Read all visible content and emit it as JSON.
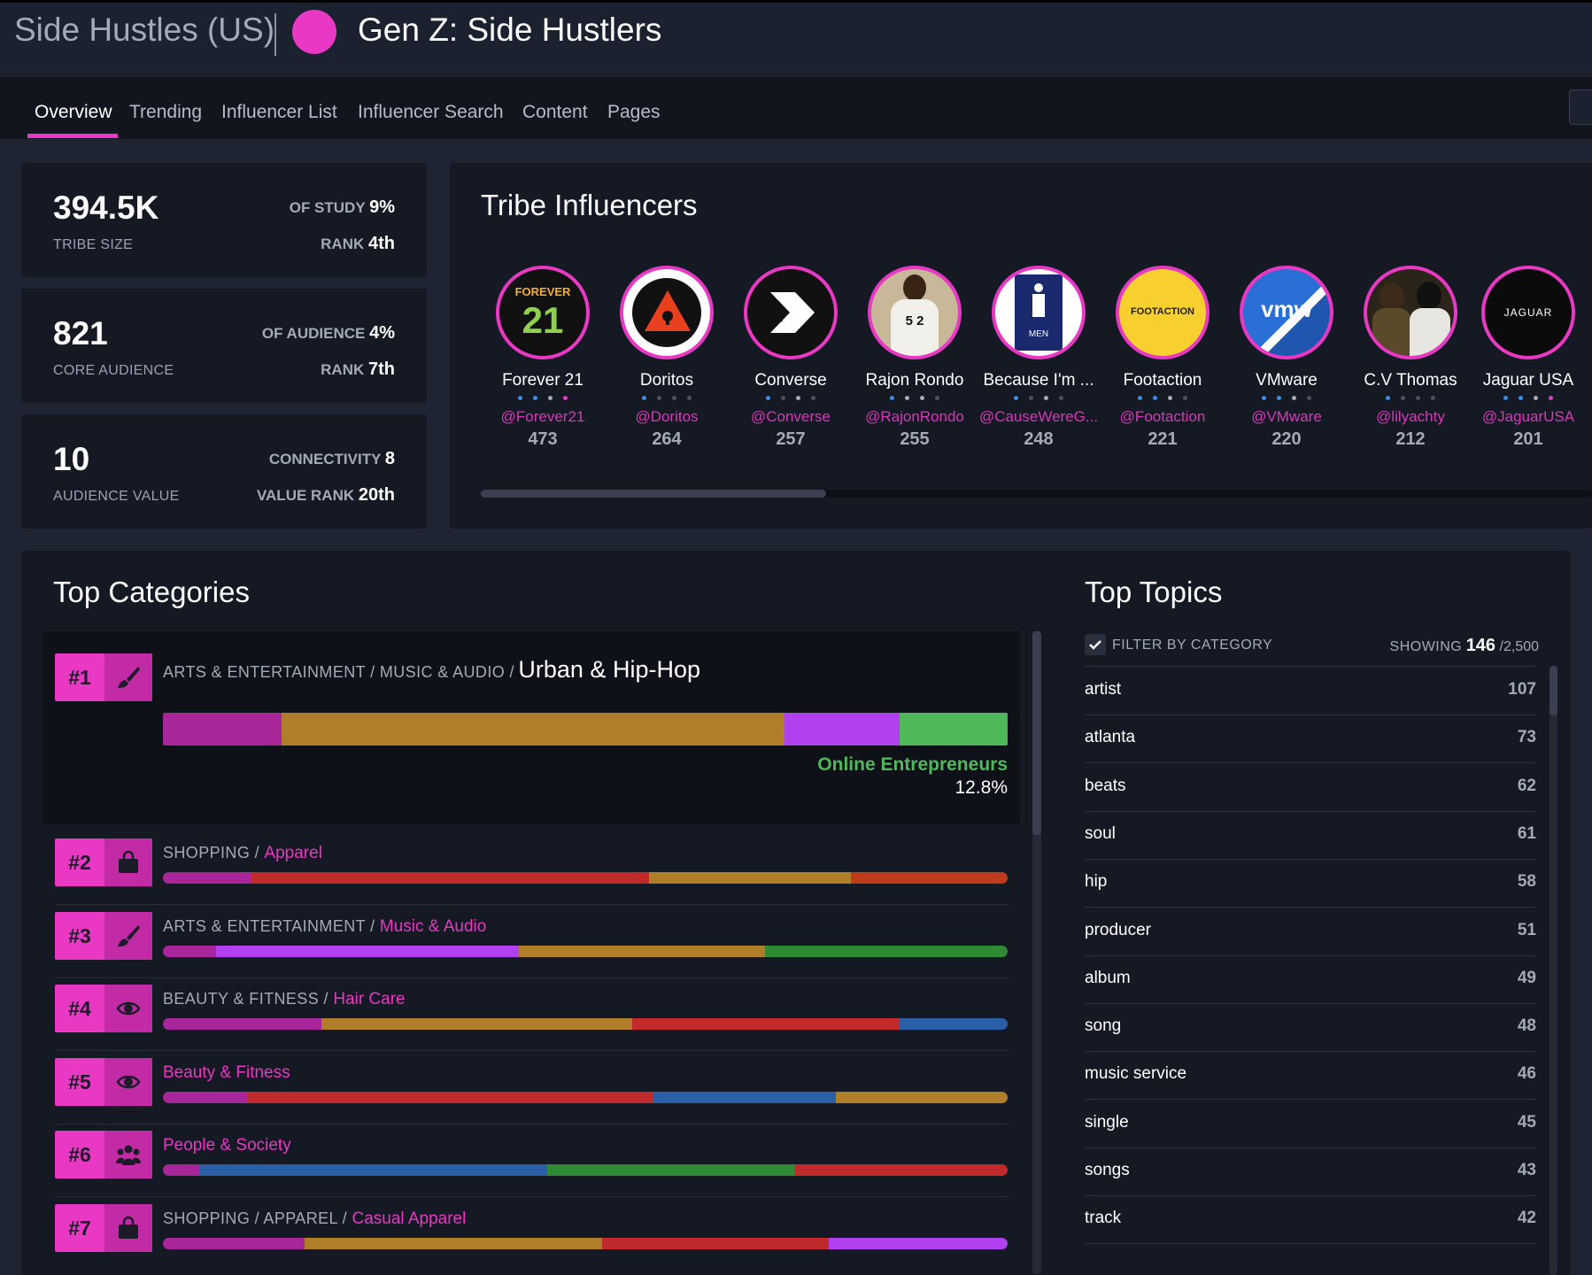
{
  "header": {
    "breadcrumb": "Side Hustles (US)",
    "title": "Gen Z: Side Hustlers",
    "accent": "#e838c4"
  },
  "tabs": [
    {
      "label": "Overview",
      "active": true
    },
    {
      "label": "Trending"
    },
    {
      "label": "Influencer List"
    },
    {
      "label": "Influencer Search"
    },
    {
      "label": "Content"
    },
    {
      "label": "Pages"
    }
  ],
  "stats": [
    {
      "big": "394.5K",
      "small": "TRIBE SIZE",
      "r1_label": "OF STUDY",
      "r1_value": "9%",
      "r2_label": "RANK",
      "r2_value": "4th"
    },
    {
      "big": "821",
      "small": "CORE AUDIENCE",
      "r1_label": "OF AUDIENCE",
      "r1_value": "4%",
      "r2_label": "RANK",
      "r2_value": "7th"
    },
    {
      "big": "10",
      "small": "AUDIENCE VALUE",
      "r1_label": "CONNECTIVITY",
      "r1_value": "8",
      "r2_label": "VALUE RANK",
      "r2_value": "20th"
    }
  ],
  "influencers_title": "Tribe Influencers",
  "influencers": [
    {
      "name": "Forever 21",
      "handle": "@Forever21",
      "count": "473",
      "avatar_text": "FOREVER 21",
      "avatar": "forever21-logo"
    },
    {
      "name": "Doritos",
      "handle": "@Doritos",
      "count": "264",
      "avatar": "doritos-logo"
    },
    {
      "name": "Converse",
      "handle": "@Converse",
      "count": "257",
      "avatar": "converse-logo"
    },
    {
      "name": "Rajon Rondo",
      "handle": "@RajonRondo",
      "count": "255",
      "avatar": "person-photo",
      "avatar_text": "5 2"
    },
    {
      "name": "Because I'm ...",
      "handle": "@CauseWereG...",
      "count": "248",
      "avatar": "restroom-sign",
      "avatar_text": "MEN"
    },
    {
      "name": "Footaction",
      "handle": "@Footaction",
      "count": "221",
      "avatar": "footaction-logo",
      "avatar_text": "FOOTACTION"
    },
    {
      "name": "VMware",
      "handle": "@VMware",
      "count": "220",
      "avatar": "vmware-logo",
      "avatar_text": "vmw"
    },
    {
      "name": "C.V Thomas",
      "handle": "@lilyachty",
      "count": "212",
      "avatar": "people-photo"
    },
    {
      "name": "Jaguar USA",
      "handle": "@JaguarUSA",
      "count": "201",
      "avatar": "jaguar-logo",
      "avatar_text": "JAGUAR"
    }
  ],
  "categories_title": "Top Categories",
  "featured_category": {
    "rank": "#1",
    "icon": "brush-icon",
    "path": "ARTS & ENTERTAINMENT / MUSIC & AUDIO /",
    "leaf": "Urban & Hip-Hop",
    "highlight_label": "Online Entrepreneurs",
    "highlight_value": "12.8%",
    "segments": [
      {
        "share": 0.14,
        "color": "#a8259a"
      },
      {
        "share": 0.596,
        "color": "#b07d28"
      },
      {
        "share": 0.136,
        "color": "#b040f0"
      },
      {
        "share": 0.128,
        "color": "#4fb85a"
      }
    ]
  },
  "categories": [
    {
      "rank": "#2",
      "icon": "shopping-bag-icon",
      "path": "SHOPPING /",
      "leaf": "Apparel",
      "segments": [
        {
          "share": 0.105,
          "color": "#a8259a"
        },
        {
          "share": 0.47,
          "color": "#c02a2a"
        },
        {
          "share": 0.24,
          "color": "#b07d28"
        },
        {
          "share": 0.185,
          "color": "#c03a1c"
        }
      ]
    },
    {
      "rank": "#3",
      "icon": "brush-icon",
      "path": "ARTS & ENTERTAINMENT /",
      "leaf": "Music & Audio",
      "segments": [
        {
          "share": 0.063,
          "color": "#a8259a"
        },
        {
          "share": 0.358,
          "color": "#b040f0"
        },
        {
          "share": 0.292,
          "color": "#b07d28"
        },
        {
          "share": 0.287,
          "color": "#2f8a34"
        }
      ]
    },
    {
      "rank": "#4",
      "icon": "eye-icon",
      "path": "BEAUTY & FITNESS /",
      "leaf": "Hair Care",
      "segments": [
        {
          "share": 0.188,
          "color": "#a8259a"
        },
        {
          "share": 0.368,
          "color": "#b07d28"
        },
        {
          "share": 0.316,
          "color": "#c02a2a"
        },
        {
          "share": 0.128,
          "color": "#2a5fa8"
        }
      ]
    },
    {
      "rank": "#5",
      "icon": "eye-icon",
      "path": "",
      "leaf": "Beauty & Fitness",
      "segments": [
        {
          "share": 0.1,
          "color": "#a8259a"
        },
        {
          "share": 0.48,
          "color": "#c02a2a"
        },
        {
          "share": 0.217,
          "color": "#2a5fa8"
        },
        {
          "share": 0.203,
          "color": "#b07d28"
        }
      ]
    },
    {
      "rank": "#6",
      "icon": "people-group-icon",
      "path": "",
      "leaf": "People & Society",
      "segments": [
        {
          "share": 0.043,
          "color": "#a8259a"
        },
        {
          "share": 0.412,
          "color": "#2a5fa8"
        },
        {
          "share": 0.293,
          "color": "#2f8a34"
        },
        {
          "share": 0.252,
          "color": "#c02a2a"
        }
      ]
    },
    {
      "rank": "#7",
      "icon": "shopping-bag-icon",
      "path": "SHOPPING / APPAREL /",
      "leaf": "Casual Apparel",
      "segments": [
        {
          "share": 0.168,
          "color": "#a8259a"
        },
        {
          "share": 0.352,
          "color": "#b07d28"
        },
        {
          "share": 0.268,
          "color": "#c02a2a"
        },
        {
          "share": 0.212,
          "color": "#b040f0"
        }
      ]
    }
  ],
  "topics_title": "Top Topics",
  "topics_filter_label": "FILTER BY CATEGORY",
  "topics_showing_label": "SHOWING",
  "topics_showing_value": "146",
  "topics_showing_total": "/2,500",
  "topics": [
    {
      "name": "artist",
      "count": "107"
    },
    {
      "name": "atlanta",
      "count": "73"
    },
    {
      "name": "beats",
      "count": "62"
    },
    {
      "name": "soul",
      "count": "61"
    },
    {
      "name": "hip",
      "count": "58"
    },
    {
      "name": "producer",
      "count": "51"
    },
    {
      "name": "album",
      "count": "49"
    },
    {
      "name": "song",
      "count": "48"
    },
    {
      "name": "music service",
      "count": "46"
    },
    {
      "name": "single",
      "count": "45"
    },
    {
      "name": "songs",
      "count": "43"
    },
    {
      "name": "track",
      "count": "42"
    }
  ]
}
